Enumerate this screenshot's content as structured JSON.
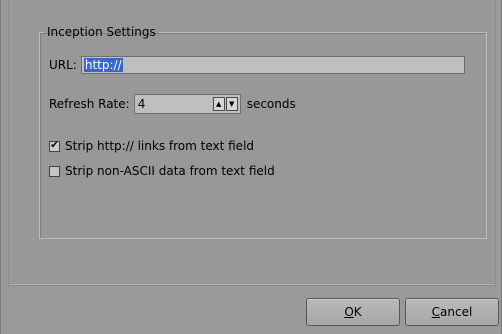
{
  "settings_group": {
    "legend": "Inception Settings",
    "url": {
      "label": "URL:",
      "value": "http://"
    },
    "refresh": {
      "label": "Refresh Rate:",
      "value": "4",
      "unit": "seconds"
    },
    "options": [
      {
        "label": "Strip http:// links from text field",
        "checked": true
      },
      {
        "label": "Strip non-ASCII data from text field",
        "checked": false
      }
    ]
  },
  "buttons": {
    "ok": {
      "mnemonic": "O",
      "rest": "K"
    },
    "cancel": {
      "mnemonic": "C",
      "rest": "ancel"
    }
  },
  "icons": {
    "spin_up": "arrow-up-icon",
    "spin_down": "arrow-down-icon",
    "checkmark": "checkmark-icon"
  },
  "colors": {
    "background": "#999999",
    "selection": "#3767d0",
    "input_background": "#bfbfbf"
  }
}
